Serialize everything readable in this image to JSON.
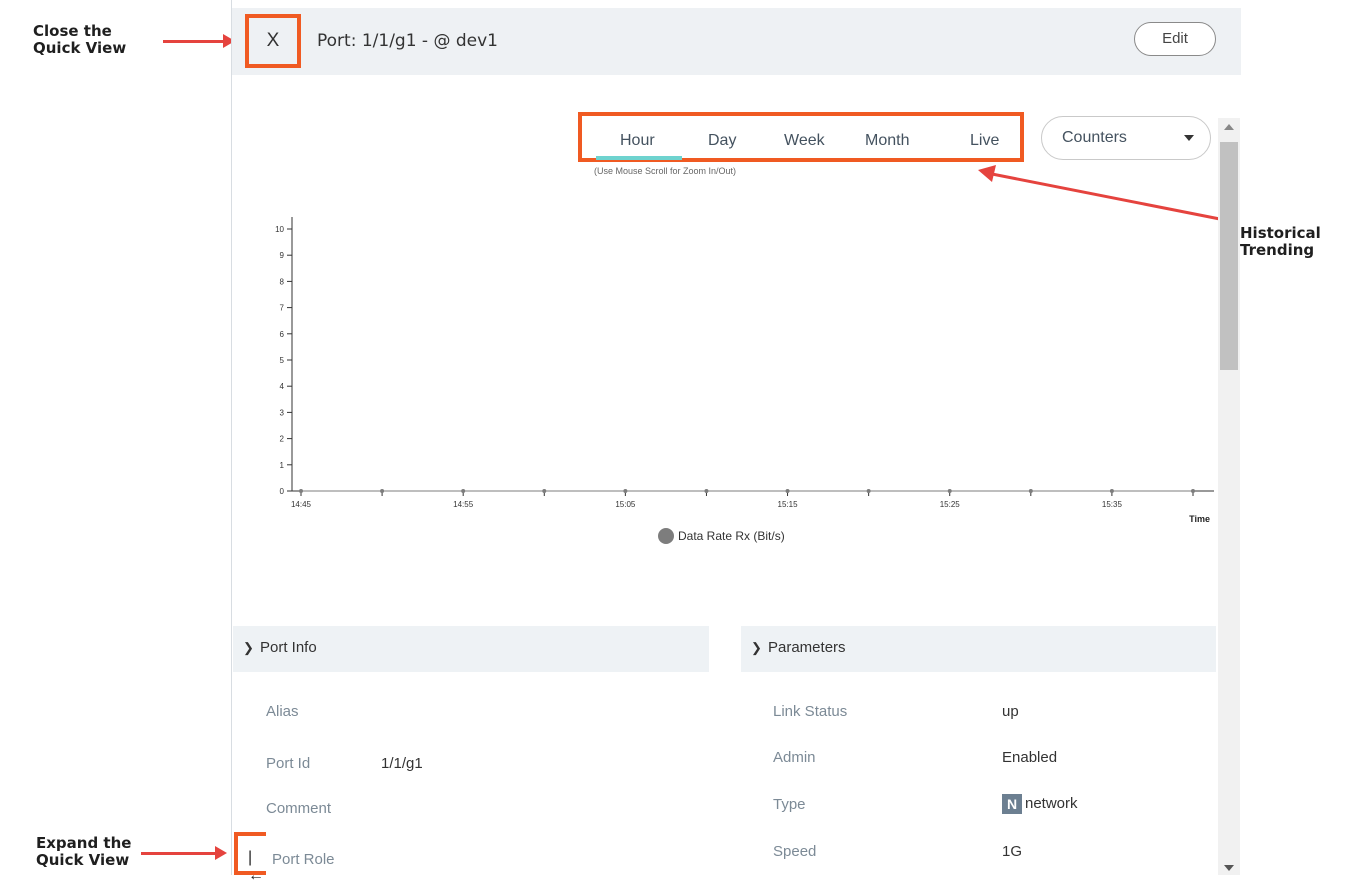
{
  "annotations": {
    "close": [
      "Close the",
      "Quick View"
    ],
    "historical": [
      "Historical",
      "Trending"
    ],
    "expand": [
      "Expand the",
      "Quick View"
    ]
  },
  "header": {
    "close_label": "X",
    "title": "Port: 1/1/g1 - @ dev1",
    "edit_label": "Edit"
  },
  "tabs": [
    {
      "label": "Hour",
      "active": true
    },
    {
      "label": "Day"
    },
    {
      "label": "Week"
    },
    {
      "label": "Month"
    },
    {
      "label": "Live"
    }
  ],
  "zoom_hint": "(Use Mouse Scroll for Zoom In/Out)",
  "dropdown": {
    "selected": "Counters"
  },
  "chart_data": {
    "type": "line",
    "y_ticks": [
      "0",
      "1",
      "2",
      "3",
      "4",
      "5",
      "6",
      "7",
      "8",
      "9",
      "10"
    ],
    "ylim": [
      0,
      10
    ],
    "x_ticks": [
      "14:45",
      "14:55",
      "15:05",
      "15:15",
      "15:25",
      "15:35"
    ],
    "xlabel": "Time",
    "series": [
      {
        "name": "Data Rate Rx (Bit/s)",
        "x": [
          "14:45",
          "14:50",
          "14:55",
          "15:00",
          "15:05",
          "15:10",
          "15:15",
          "15:20",
          "15:25",
          "15:30",
          "15:35",
          "15:40"
        ],
        "values": [
          0,
          0,
          0,
          0,
          0,
          0,
          0,
          0,
          0,
          0,
          0,
          0
        ],
        "color": "#7d7d7d"
      }
    ]
  },
  "port_info": {
    "heading": "Port Info",
    "rows": [
      {
        "label": "Alias",
        "value": ""
      },
      {
        "label": "Port Id",
        "value": "1/1/g1"
      },
      {
        "label": "Comment",
        "value": ""
      },
      {
        "label": "Port Role",
        "value": ""
      }
    ]
  },
  "parameters": {
    "heading": "Parameters",
    "rows": [
      {
        "label": "Link Status",
        "value": "up"
      },
      {
        "label": "Admin",
        "value": "Enabled"
      },
      {
        "label": "Type",
        "value": "network",
        "badge": "N"
      },
      {
        "label": "Speed",
        "value": "1G"
      }
    ]
  },
  "expand_icon": "expand-left-icon",
  "colors": {
    "highlight": "#f05a22",
    "arrow": "#e5433e",
    "active_tab": "#6ed3cf"
  }
}
